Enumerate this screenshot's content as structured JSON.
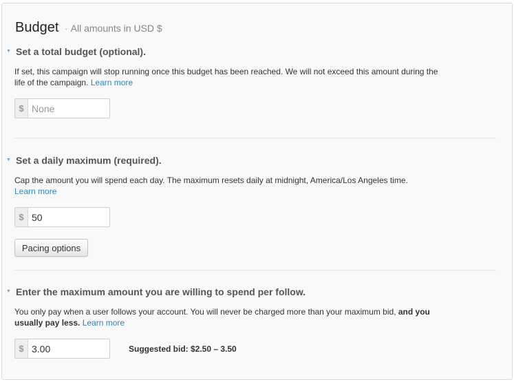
{
  "header": {
    "title": "Budget",
    "separator": "·",
    "subtitle": "All amounts in USD $"
  },
  "total_budget": {
    "title": "Set a total budget (optional).",
    "description": "If set, this campaign will stop running once this budget has been reached. We will not exceed this amount during the life of the campaign.",
    "learn_more": "Learn more",
    "currency": "$",
    "value": "",
    "placeholder": "None"
  },
  "daily_max": {
    "title": "Set a daily maximum (required).",
    "description": "Cap the amount you will spend each day. The maximum resets daily at midnight, America/Los Angeles time.",
    "learn_more": "Learn more",
    "currency": "$",
    "value": "50",
    "pacing_button": "Pacing options"
  },
  "max_bid": {
    "title": "Enter the maximum amount you are willing to spend per follow.",
    "description": "You only pay when a user follows your account. You will never be charged more than your maximum bid,",
    "description_bold": "and you usually pay less.",
    "learn_more": "Learn more",
    "currency": "$",
    "value": "3.00",
    "suggested_bid": "Suggested bid: $2.50 – 3.50"
  },
  "colors": {
    "link": "#2a86c5",
    "caret": "#6aa3cc",
    "panel_bg": "#f9f9f9"
  },
  "icons": {
    "section_caret": "caret-down-icon"
  }
}
